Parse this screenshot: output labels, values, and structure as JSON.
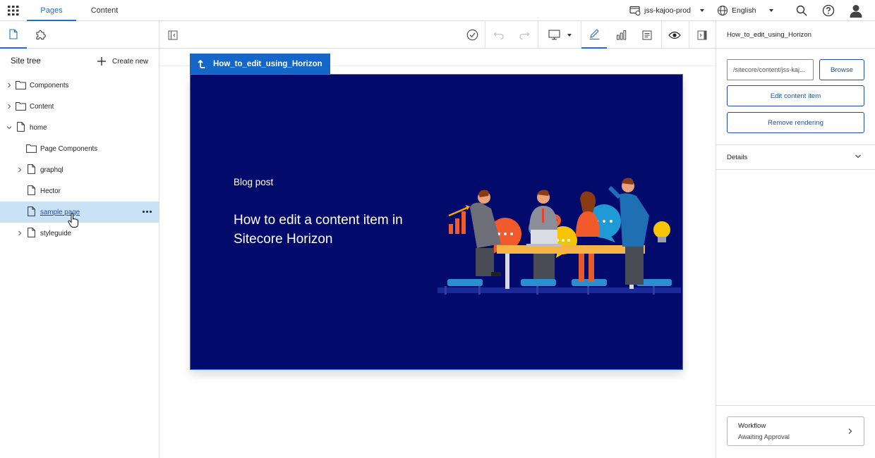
{
  "topbar": {
    "tabs": [
      {
        "label": "Pages"
      },
      {
        "label": "Content"
      }
    ],
    "site_selector": "jss-kajoo-prod",
    "language_selector": "English"
  },
  "left_panel": {
    "title": "Site tree",
    "create_new_label": "Create new",
    "tree": [
      {
        "label": "Components"
      },
      {
        "label": "Content"
      },
      {
        "label": "home"
      },
      {
        "label": "Page Components"
      },
      {
        "label": "graphql"
      },
      {
        "label": "Hector"
      },
      {
        "label": "sample page"
      },
      {
        "label": "styleguide"
      }
    ]
  },
  "canvas": {
    "component_label": "How_to_edit_using_Horizon",
    "hero": {
      "kicker": "Blog post",
      "title": "How to edit a content item in Sitecore Horizon"
    }
  },
  "right_panel": {
    "title": "How_to_edit_using_Horizon",
    "datasource_path": "/sitecore/content/jss-kaj...",
    "browse_label": "Browse",
    "edit_content_item_label": "Edit content item",
    "remove_rendering_label": "Remove rendering",
    "details_label": "Details",
    "workflow": {
      "title": "Workflow",
      "state": "Awaiting Approval"
    }
  },
  "colors": {
    "accent": "#1f6fc9",
    "hero_background": "#020b6c",
    "selected_row": "#c9e2f5"
  }
}
